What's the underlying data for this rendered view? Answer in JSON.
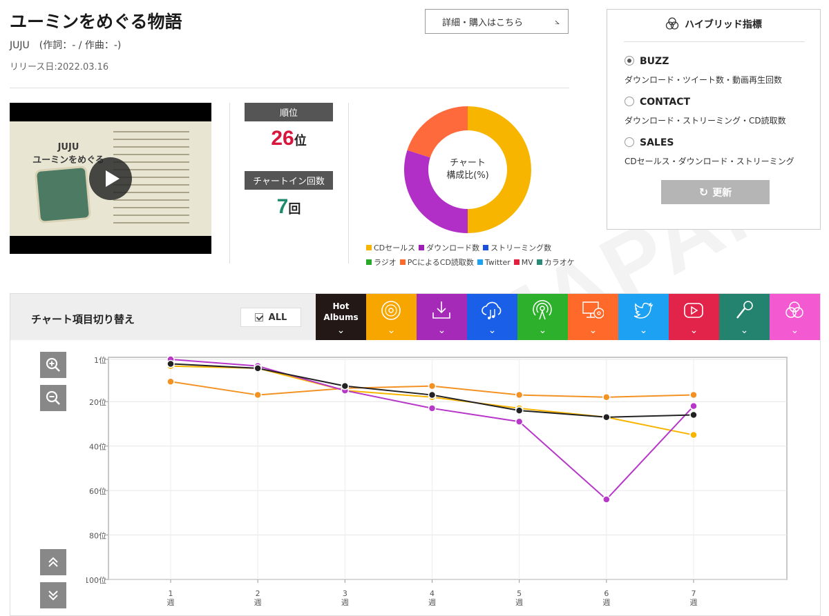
{
  "song": {
    "title": "ユーミンをめぐる物語",
    "artist_line": "JUJU　(作詞：- / 作曲：-)",
    "release": "リリース日:2022.03.16",
    "buy_label": "詳細・購入はこちら"
  },
  "video": {
    "thumb_title": "JUJU\nユーミンをめぐる物語"
  },
  "stats": {
    "rank_label": "順位",
    "rank_value": "26",
    "rank_unit": "位",
    "rank_color": "#d6163c",
    "chartin_label": "チャートイン回数",
    "chartin_value": "7",
    "chartin_unit": "回",
    "chartin_color": "#1f8a6c"
  },
  "donut": {
    "center_line1": "チャート",
    "center_line2": "構成比(%)",
    "legend": [
      {
        "label": "CDセールス",
        "color": "#f7b500"
      },
      {
        "label": "ダウンロード数",
        "color": "#9b1fb5"
      },
      {
        "label": "ストリーミング数",
        "color": "#1a4fe0"
      },
      {
        "label": "ラジオ",
        "color": "#2aa82a"
      },
      {
        "label": "PCによるCD読取数",
        "color": "#ff6a2b"
      },
      {
        "label": "Twitter",
        "color": "#1da1f2"
      },
      {
        "label": "MV",
        "color": "#e0203f"
      },
      {
        "label": "カラオケ",
        "color": "#2a8a78"
      }
    ]
  },
  "hybrid": {
    "title": "ハイブリッド指標",
    "options": [
      {
        "label": "BUZZ",
        "desc": "ダウンロード・ツイート数・動画再生回数",
        "selected": true
      },
      {
        "label": "CONTACT",
        "desc": "ダウンロード・ストリーミング・CD読取数",
        "selected": false
      },
      {
        "label": "SALES",
        "desc": "CDセールス・ダウンロード・ストリーミング",
        "selected": false
      }
    ],
    "refresh_label": "更新"
  },
  "panel": {
    "switch_label": "チャート項目切り替え",
    "all_label": "ALL",
    "tabs": [
      {
        "name": "tab-hot-albums",
        "label": "Hot\nAlbums",
        "color": "#231815",
        "icon": "hot-albums"
      },
      {
        "name": "tab-cd-sales",
        "label": "",
        "color": "#f7a600",
        "icon": "cd-icon"
      },
      {
        "name": "tab-download",
        "label": "",
        "color": "#a52ab8",
        "icon": "download-icon"
      },
      {
        "name": "tab-streaming",
        "label": "",
        "color": "#1a5fe8",
        "icon": "cloud-music-icon"
      },
      {
        "name": "tab-radio",
        "label": "",
        "color": "#2db12d",
        "icon": "radio-icon"
      },
      {
        "name": "tab-pc-cd-read",
        "label": "",
        "color": "#ff6a2b",
        "icon": "pc-cd-icon"
      },
      {
        "name": "tab-twitter",
        "label": "",
        "color": "#1da1f2",
        "icon": "twitter-icon"
      },
      {
        "name": "tab-mv",
        "label": "",
        "color": "#e3244a",
        "icon": "play-icon"
      },
      {
        "name": "tab-karaoke",
        "label": "",
        "color": "#24836f",
        "icon": "mic-icon"
      },
      {
        "name": "tab-hybrid",
        "label": "",
        "color": "#f35ad2",
        "icon": "hybrid-icon"
      }
    ]
  },
  "chart_data": [
    {
      "type": "pie",
      "title": "チャート構成比(%)",
      "categories": [
        "CDセールス",
        "ダウンロード数",
        "PCによるCD読取数"
      ],
      "values": [
        50,
        30,
        20
      ],
      "colors": [
        "#f7b500",
        "#b12fc6",
        "#ff6a3d"
      ]
    },
    {
      "type": "line",
      "categories": [
        "1\n週",
        "2\n週",
        "3\n週",
        "4\n週",
        "5\n週",
        "6\n週",
        "7\n週"
      ],
      "y_ticks": [
        "1位",
        "20位",
        "40位",
        "60位",
        "80位",
        "100位"
      ],
      "y_tick_values": [
        1,
        20,
        40,
        60,
        80,
        100
      ],
      "ylim": [
        1,
        100
      ],
      "y_inverted": true,
      "grid": true,
      "series": [
        {
          "values": [
            4,
            5,
            15,
            18,
            23,
            27,
            35
          ],
          "color": "#f7b500"
        },
        {
          "values": [
            11,
            17,
            14,
            13,
            17,
            18,
            17
          ],
          "color": "#f39222"
        },
        {
          "values": [
            1,
            4,
            15,
            23,
            29,
            64,
            22
          ],
          "color": "#b737c9"
        },
        {
          "values": [
            3,
            5,
            13,
            17,
            24,
            27,
            26
          ],
          "color": "#222222"
        }
      ]
    }
  ]
}
